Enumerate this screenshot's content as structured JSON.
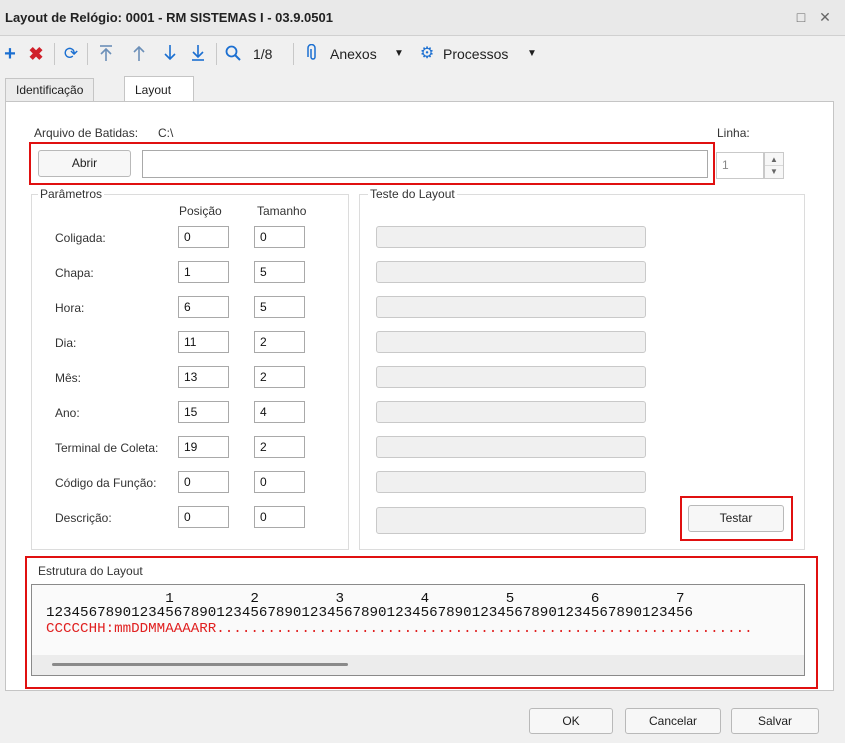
{
  "window": {
    "title": "Layout de Relógio: 0001 - RM SISTEMAS I - 03.9.0501",
    "maximize_glyph": "□",
    "close_glyph": "✕"
  },
  "toolbar": {
    "add_icon": "plus-icon",
    "delete_icon": "x-icon",
    "refresh_icon": "refresh-icon",
    "page_counter": "1/8",
    "anexos_label": "Anexos",
    "processos_label": "Processos"
  },
  "tabs": [
    {
      "label": "Identificação",
      "active": false
    },
    {
      "label": "Layout",
      "active": true
    }
  ],
  "arquivo": {
    "label": "Arquivo de Batidas:",
    "path": "C:\\",
    "abrir_label": "Abrir",
    "file_value": ""
  },
  "linha": {
    "label": "Linha:",
    "value": "1"
  },
  "parametros": {
    "title": "Parâmetros",
    "col_posicao": "Posição",
    "col_tamanho": "Tamanho",
    "rows": [
      {
        "label": "Coligada:",
        "posicao": "0",
        "tamanho": "0"
      },
      {
        "label": "Chapa:",
        "posicao": "1",
        "tamanho": "5"
      },
      {
        "label": "Hora:",
        "posicao": "6",
        "tamanho": "5"
      },
      {
        "label": "Dia:",
        "posicao": "11",
        "tamanho": "2"
      },
      {
        "label": "Mês:",
        "posicao": "13",
        "tamanho": "2"
      },
      {
        "label": "Ano:",
        "posicao": "15",
        "tamanho": "4"
      },
      {
        "label": "Terminal de Coleta:",
        "posicao": "19",
        "tamanho": "2"
      },
      {
        "label": "Código da Função:",
        "posicao": "0",
        "tamanho": "0"
      },
      {
        "label": "Descrição:",
        "posicao": "0",
        "tamanho": "0"
      }
    ]
  },
  "teste": {
    "title": "Teste do Layout",
    "testar_label": "Testar"
  },
  "estrutura": {
    "title": "Estrutura do Layout",
    "ruler_tens": "              1         2         3         4         5         6         7",
    "ruler_units": "1234567890123456789012345678901234567890123456789012345678901234567890123456",
    "layout_code": "CCCCCHH:mmDDMMAAAARR...............................................................",
    "layout_color": "#e02020"
  },
  "footer": {
    "ok_label": "OK",
    "cancelar_label": "Cancelar",
    "salvar_label": "Salvar"
  },
  "highlight_color": "#e01010"
}
